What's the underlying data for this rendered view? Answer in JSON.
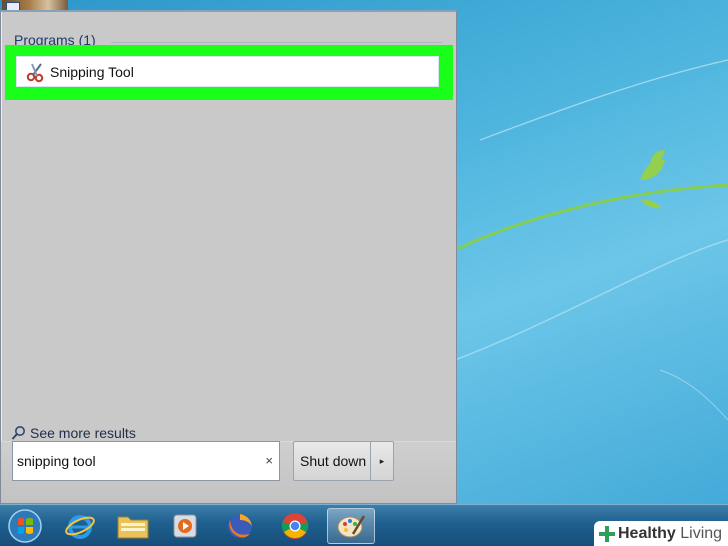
{
  "start_menu": {
    "section_header": "Programs (1)",
    "results": [
      {
        "label": "Snipping Tool",
        "icon": "scissors-icon"
      }
    ],
    "see_more": "See more results",
    "search": {
      "value": "snipping tool",
      "clear_glyph": "×"
    },
    "shutdown": {
      "label": "Shut down",
      "arrow": "▸"
    }
  },
  "taskbar": {
    "items": [
      {
        "name": "start-orb",
        "icon": "windows-logo-icon"
      },
      {
        "name": "internet-explorer",
        "icon": "ie-icon"
      },
      {
        "name": "windows-explorer",
        "icon": "folder-icon"
      },
      {
        "name": "media-player",
        "icon": "media-player-icon"
      },
      {
        "name": "firefox",
        "icon": "firefox-icon"
      },
      {
        "name": "chrome",
        "icon": "chrome-icon"
      },
      {
        "name": "paint",
        "icon": "paint-icon",
        "active": true
      }
    ]
  },
  "watermark": {
    "brand_bold": "Healthy",
    "brand_light": "Living"
  },
  "colors": {
    "highlight": "#1aff1a",
    "menu_bg": "#c9c9c9",
    "taskbar": "#1f5f8f",
    "desktop": "#4bb3dd"
  }
}
